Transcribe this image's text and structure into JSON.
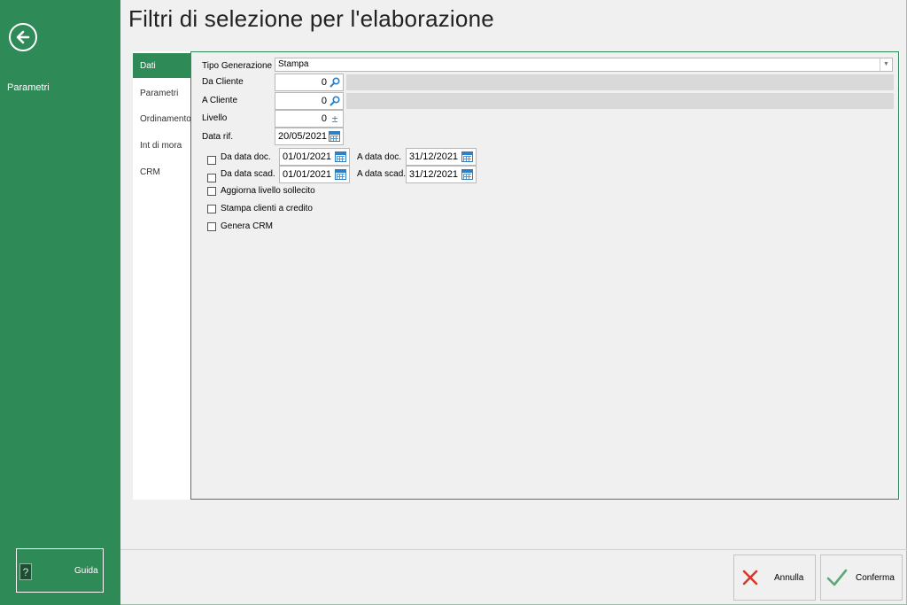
{
  "sidebar": {
    "back_icon": "arrow-left-circle-icon",
    "section_label": "Parametri",
    "help_label": "Guida",
    "help_icon": "help-book-icon",
    "help_glyph": "?"
  },
  "page_title": "Filtri di selezione per l'elaborazione",
  "tabs": [
    {
      "label": "Dati",
      "active": true
    },
    {
      "label": "Parametri"
    },
    {
      "label": "Ordinamento"
    },
    {
      "label": "Int di mora"
    },
    {
      "label": "CRM"
    }
  ],
  "form": {
    "tipo_generazione_label": "Tipo Generazione",
    "tipo_generazione_value": "Stampa",
    "da_cliente_label": "Da Cliente",
    "da_cliente_value": "0",
    "a_cliente_label": "A Cliente",
    "a_cliente_value": "0",
    "livello_label": "Livello",
    "livello_value": "0",
    "livello_spin_glyph": "±",
    "data_rif_label": "Data rif.",
    "data_rif_value": "20/05/2021",
    "da_data_doc_label": "Da data doc.",
    "da_data_doc_value": "01/01/2021",
    "a_data_doc_label": "A data doc.",
    "a_data_doc_value": "31/12/2021",
    "da_data_scad_label": "Da data scad.",
    "da_data_scad_value": "01/01/2021",
    "a_data_scad_label": "A data scad.",
    "a_data_scad_value": "31/12/2021",
    "aggiorna_label": "Aggiorna livello sollecito",
    "stampa_clienti_label": "Stampa clienti a credito",
    "genera_crm_label": "Genera CRM"
  },
  "footer": {
    "cancel_label": "Annulla",
    "confirm_label": "Conferma"
  },
  "colors": {
    "brand_green": "#2e8b57",
    "accent_blue": "#2f7fc2",
    "cancel_red": "#d9362a",
    "confirm_green": "#5aa87a"
  }
}
